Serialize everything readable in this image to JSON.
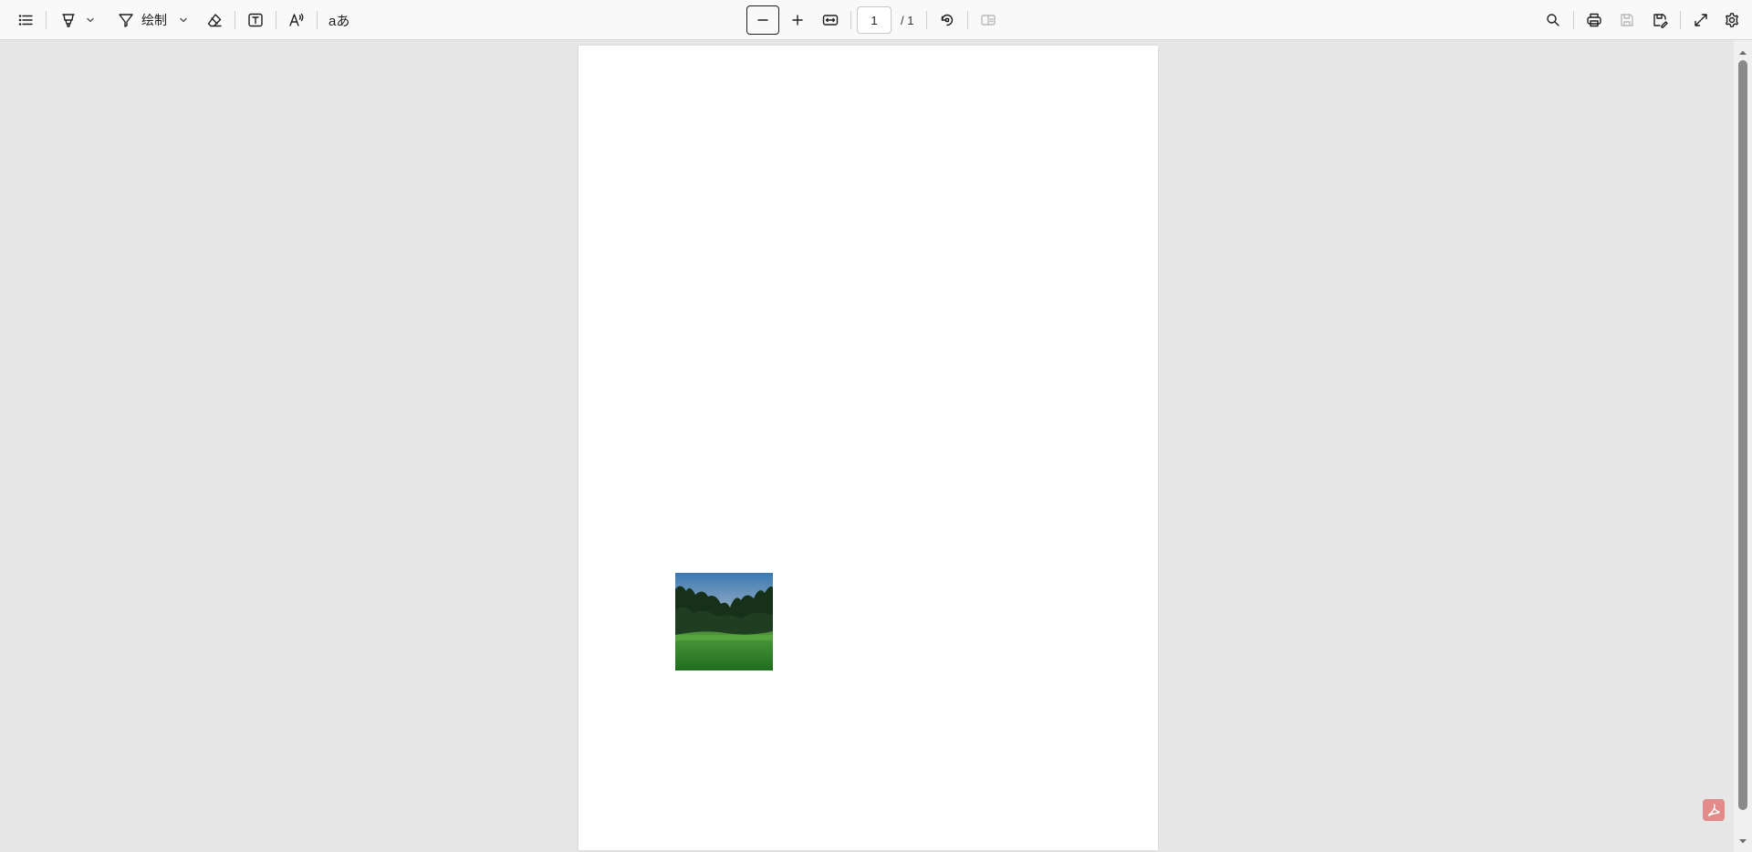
{
  "toolbar": {
    "draw_label": "绘制",
    "translate_glyph": "aあ",
    "page": {
      "current": "1",
      "total": "/ 1"
    }
  },
  "icons": {
    "contents": "list-icon",
    "highlight": "highlighter-icon",
    "draw": "pen-icon",
    "erase": "eraser-icon",
    "textbox": "text-box-icon",
    "read_aloud": "read-aloud-icon",
    "zoom_out": "minus-icon",
    "zoom_in": "plus-icon",
    "fit": "fit-width-icon",
    "rotate": "rotate-icon",
    "two_page": "page-view-icon",
    "search": "search-icon",
    "print": "print-icon",
    "save": "save-icon",
    "save_as": "save-as-icon",
    "fullscreen": "expand-icon",
    "settings": "gear-icon",
    "acrobat": "acrobat-icon"
  },
  "document": {
    "image": "landscape-photo"
  },
  "colors": {
    "toolbar_bg": "#f9f9f9",
    "viewport_bg": "#e6e6e6",
    "page_bg": "#ffffff",
    "acrobat_badge": "#e38a8a"
  }
}
